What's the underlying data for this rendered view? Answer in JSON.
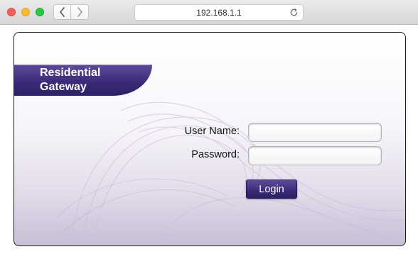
{
  "browser": {
    "url": "192.168.1.1"
  },
  "page": {
    "brand_title": "Residential Gateway",
    "username_label": "User Name:",
    "username_value": "",
    "password_label": "Password:",
    "password_value": "",
    "login_label": "Login"
  },
  "colors": {
    "brand": "#3b2b78",
    "background_bottom": "#c7bfd6"
  },
  "icons": [
    "back-arrow-icon",
    "forward-arrow-icon",
    "reload-icon"
  ]
}
